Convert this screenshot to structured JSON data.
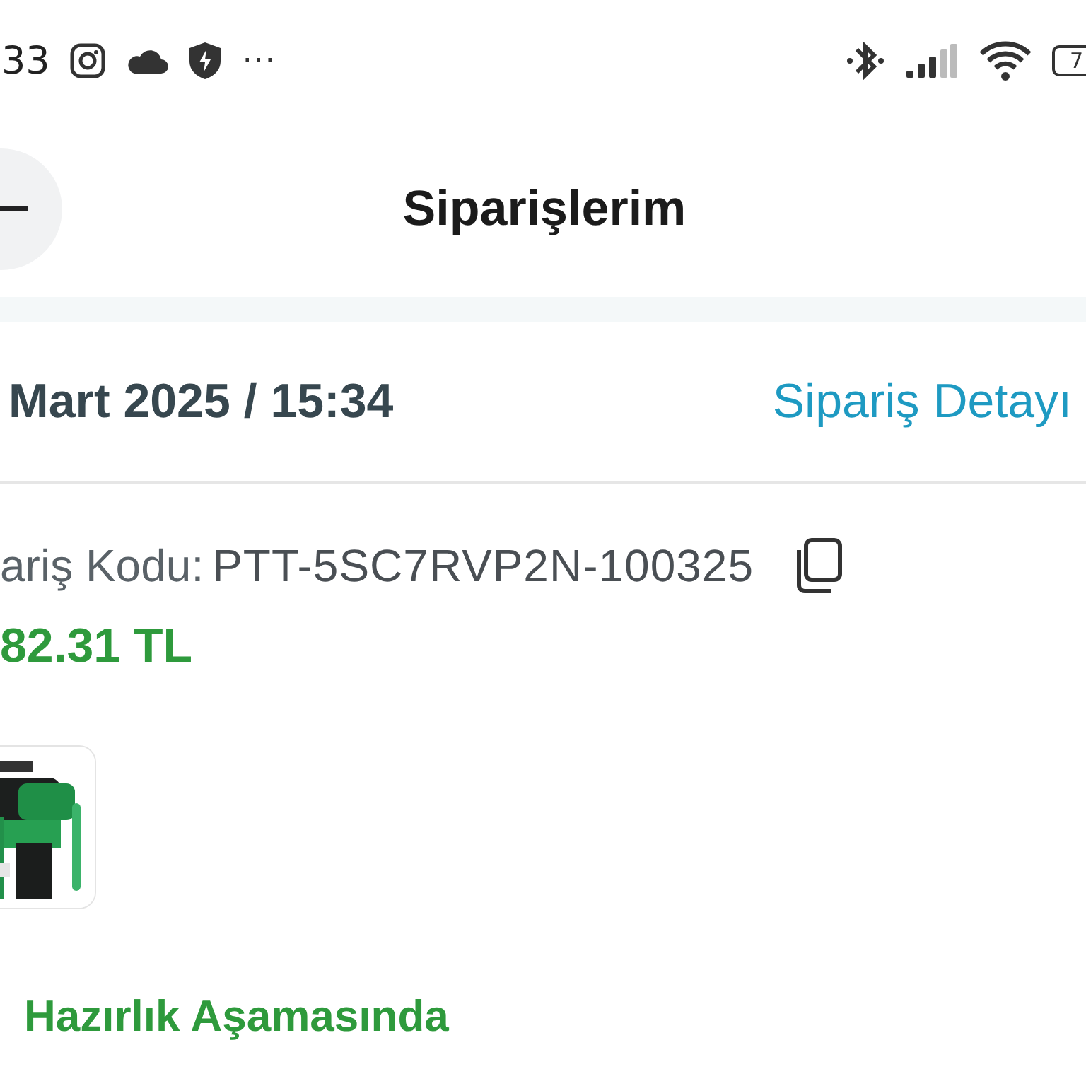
{
  "status_bar": {
    "time": "33",
    "more": "···",
    "battery": "7"
  },
  "header": {
    "title": "Siparişlerim"
  },
  "order": {
    "date": "Mart 2025 / 15:34",
    "detail_link": "Sipariş Detayı",
    "code_label": "ariş Kodu:",
    "code": "PTT-5SC7RVP2N-100325",
    "price": "82.31 TL",
    "status": "Hazırlık Aşamasında"
  }
}
